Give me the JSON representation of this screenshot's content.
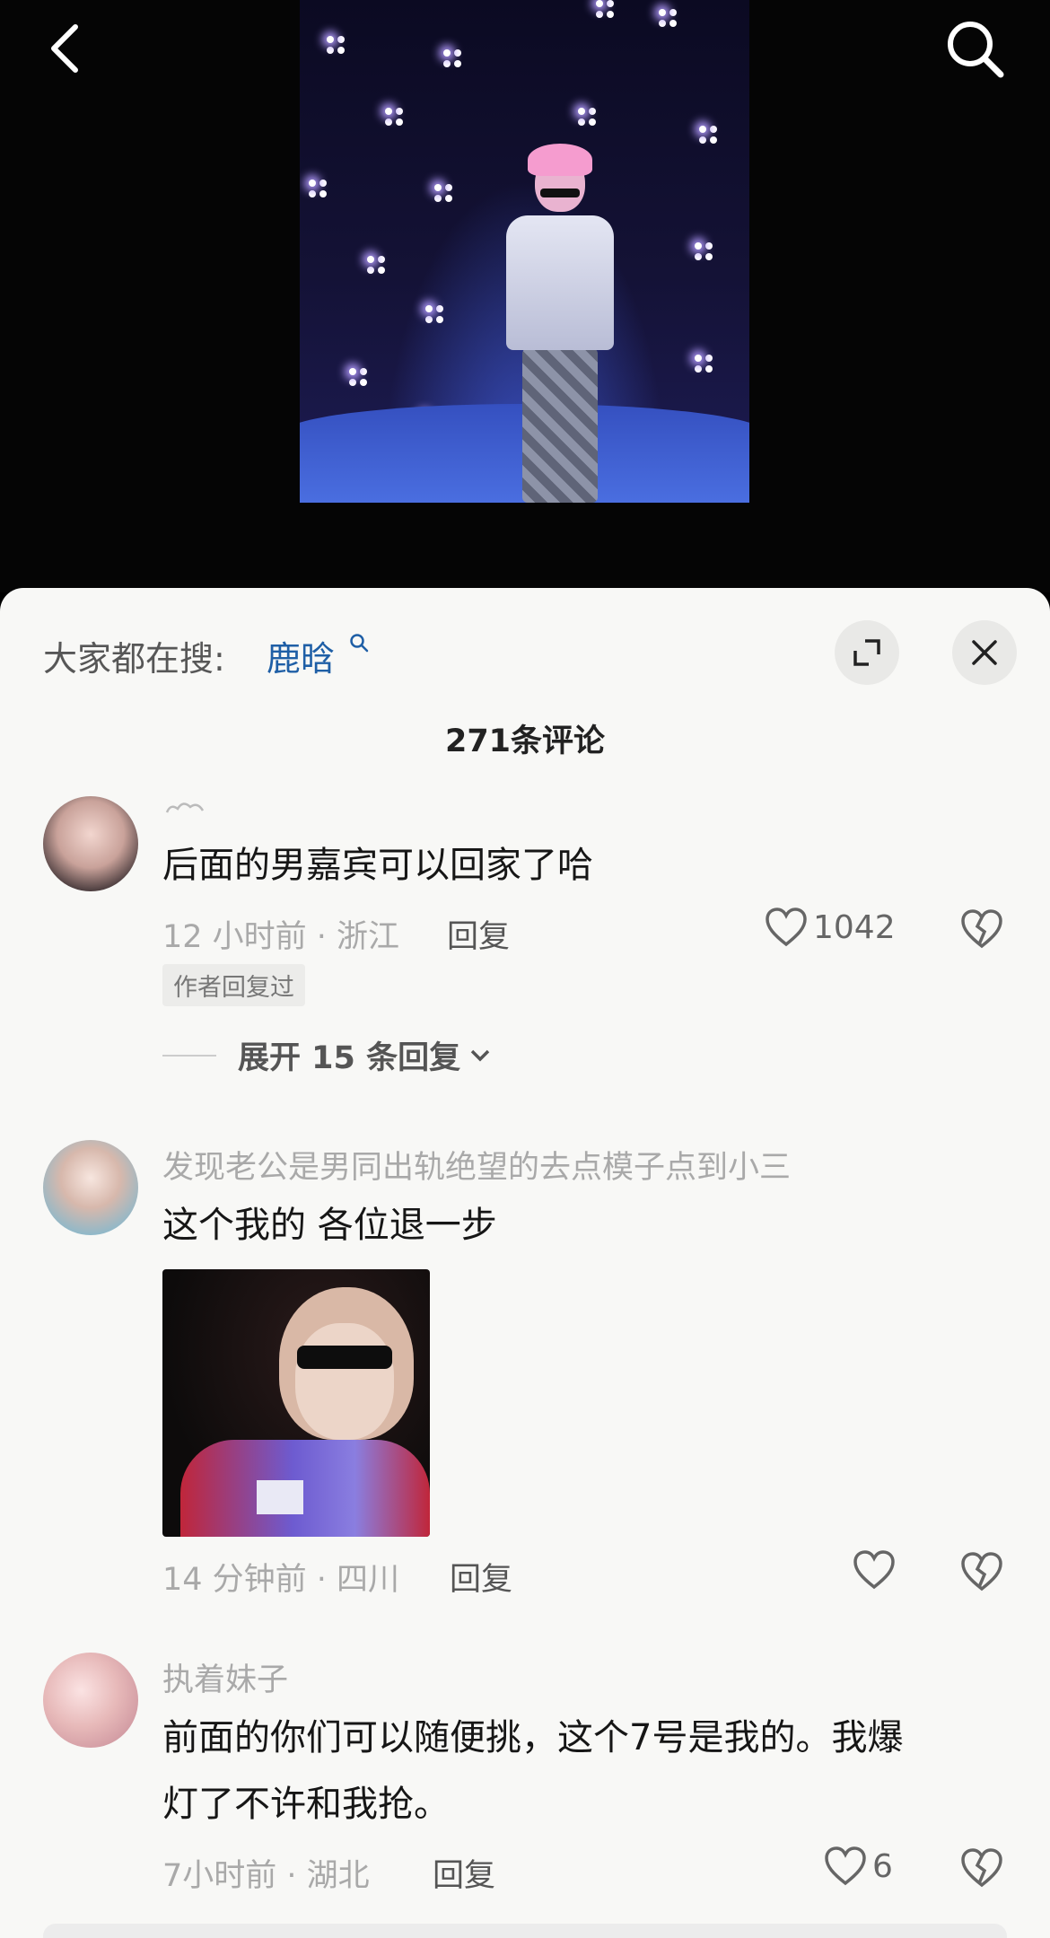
{
  "topbar": {
    "back_icon": "chevron-left-icon",
    "search_icon": "search-icon"
  },
  "video": {
    "description_icon": "concert-video-thumbnail"
  },
  "sheet": {
    "search_prefix": "大家都在搜:",
    "search_term": "鹿晗",
    "expand_icon": "expand-icon",
    "close_icon": "close-icon",
    "comment_count": "271条评论"
  },
  "comments": [
    {
      "username": "",
      "text": "后面的男嘉宾可以回家了哈",
      "time": "12 小时前",
      "location": "浙江",
      "meta": "12 小时前 · 浙江",
      "reply_label": "回复",
      "likes": "1042",
      "badge": "作者回复过",
      "expand_label": "展开 15 条回复"
    },
    {
      "username": "发现老公是男同出轨绝望的去点模子点到小三",
      "text": "这个我的 各位退一步",
      "meta": "14 分钟前 · 四川",
      "reply_label": "回复",
      "likes": ""
    },
    {
      "username": "执着妹子",
      "text_line1": "前面的你们可以随便挑，这个7号是我的。我爆",
      "text_line2": "灯了不许和我抢。",
      "meta": "7小时前 · 湖北",
      "reply_label": "回复",
      "likes": "6"
    }
  ],
  "colors": {
    "sheet_bg": "#f8f8f6",
    "link_blue": "#1f5fa6",
    "muted": "#a9a9a9"
  }
}
